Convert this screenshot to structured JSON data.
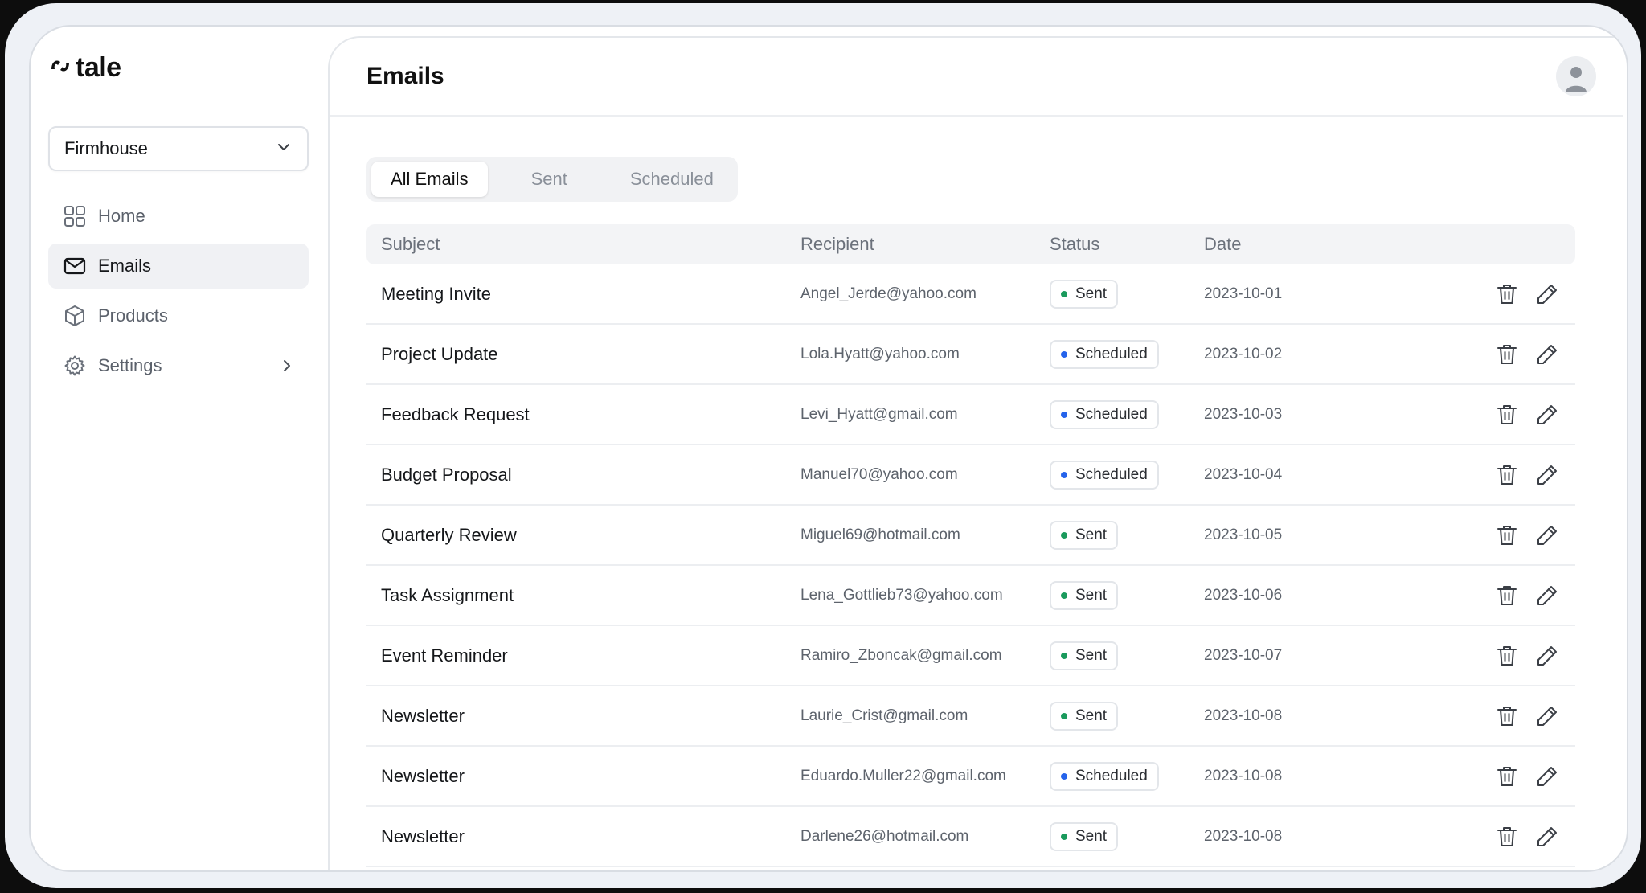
{
  "app": {
    "logo_text": "tale"
  },
  "sidebar": {
    "org_select": {
      "value": "Firmhouse"
    },
    "items": [
      {
        "label": "Home",
        "icon": "grid-icon"
      },
      {
        "label": "Emails",
        "icon": "mail-icon",
        "active": true
      },
      {
        "label": "Products",
        "icon": "box-icon"
      },
      {
        "label": "Settings",
        "icon": "gear-icon",
        "has_submenu": true
      }
    ]
  },
  "header": {
    "title": "Emails"
  },
  "tabs": [
    {
      "label": "All Emails",
      "active": true
    },
    {
      "label": "Sent"
    },
    {
      "label": "Scheduled"
    }
  ],
  "table": {
    "columns": [
      "Subject",
      "Recipient",
      "Status",
      "Date"
    ],
    "rows": [
      {
        "subject": "Meeting Invite",
        "recipient": "Angel_Jerde@yahoo.com",
        "status": "Sent",
        "date": "2023-10-01"
      },
      {
        "subject": "Project Update",
        "recipient": "Lola.Hyatt@yahoo.com",
        "status": "Scheduled",
        "date": "2023-10-02"
      },
      {
        "subject": "Feedback Request",
        "recipient": "Levi_Hyatt@gmail.com",
        "status": "Scheduled",
        "date": "2023-10-03"
      },
      {
        "subject": "Budget Proposal",
        "recipient": "Manuel70@yahoo.com",
        "status": "Scheduled",
        "date": "2023-10-04"
      },
      {
        "subject": "Quarterly Review",
        "recipient": "Miguel69@hotmail.com",
        "status": "Sent",
        "date": "2023-10-05"
      },
      {
        "subject": "Task Assignment",
        "recipient": "Lena_Gottlieb73@yahoo.com",
        "status": "Sent",
        "date": "2023-10-06"
      },
      {
        "subject": "Event Reminder",
        "recipient": "Ramiro_Zboncak@gmail.com",
        "status": "Sent",
        "date": "2023-10-07"
      },
      {
        "subject": "Newsletter",
        "recipient": "Laurie_Crist@gmail.com",
        "status": "Sent",
        "date": "2023-10-08"
      },
      {
        "subject": "Newsletter",
        "recipient": "Eduardo.Muller22@gmail.com",
        "status": "Scheduled",
        "date": "2023-10-08"
      },
      {
        "subject": "Newsletter",
        "recipient": "Darlene26@hotmail.com",
        "status": "Sent",
        "date": "2023-10-08"
      }
    ]
  },
  "colors": {
    "sent_dot": "#1a9a5c",
    "scheduled_dot": "#2563eb"
  }
}
